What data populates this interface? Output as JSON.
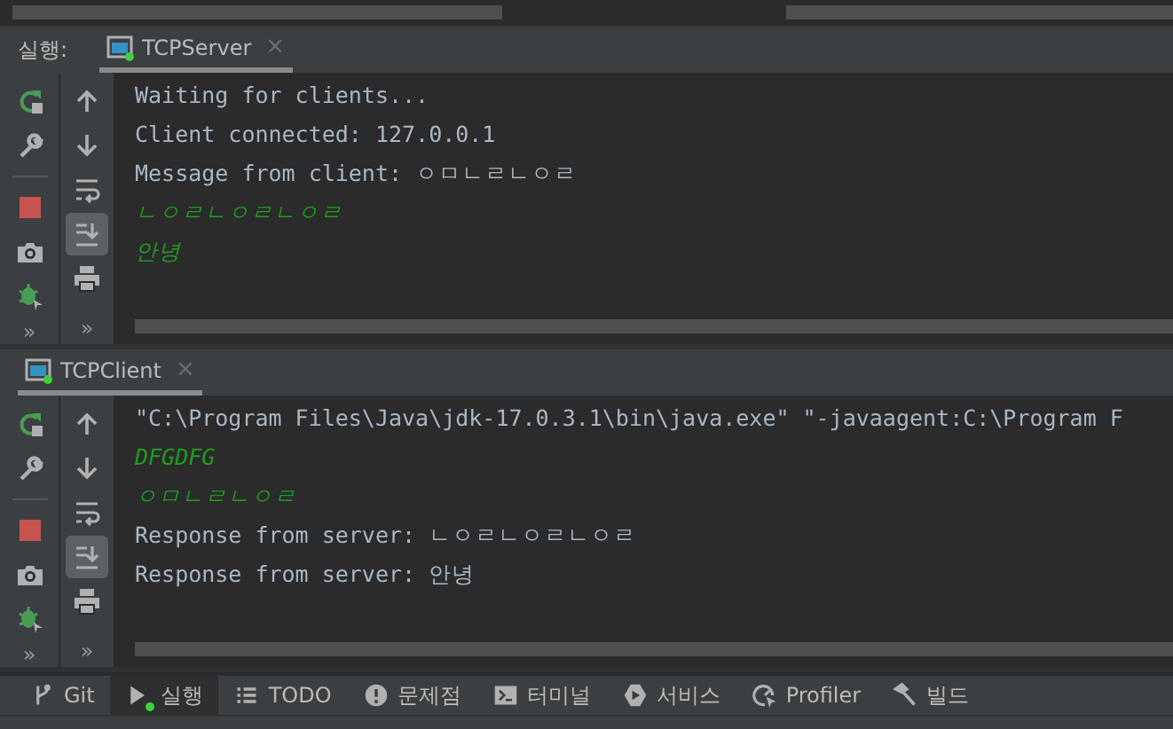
{
  "consoles": [
    {
      "label": "실행:",
      "tab": {
        "title": "TCPServer",
        "close": "×",
        "running": true
      },
      "more_left": "»",
      "more_right": "»",
      "soft_wrap_on": false,
      "scroll_to_end_on": true,
      "lines": [
        {
          "text": "Waiting for clients...",
          "kind": "output"
        },
        {
          "text": "Client connected: 127.0.0.1",
          "kind": "output"
        },
        {
          "text": "Message from client: ㅇㅁㄴㄹㄴㅇㄹ",
          "kind": "output"
        },
        {
          "text": "ㄴㅇㄹㄴㅇㄹㄴㅇㄹ",
          "kind": "input"
        },
        {
          "text": "안녕",
          "kind": "input"
        }
      ]
    },
    {
      "tab": {
        "title": "TCPClient",
        "close": "×",
        "running": true
      },
      "more_left": "»",
      "more_right": "»",
      "soft_wrap_on": false,
      "scroll_to_end_on": true,
      "lines": [
        {
          "text": "\"C:\\Program Files\\Java\\jdk-17.0.3.1\\bin\\java.exe\" \"-javaagent:C:\\Program F",
          "kind": "output"
        },
        {
          "text": "DFGDFG",
          "kind": "input"
        },
        {
          "text": "ㅇㅁㄴㄹㄴㅇㄹ",
          "kind": "input"
        },
        {
          "text": "Response from server: ㄴㅇㄹㄴㅇㄹㄴㅇㄹ",
          "kind": "output"
        },
        {
          "text": "Response from server: 안녕",
          "kind": "output"
        }
      ]
    }
  ],
  "bottom_tabs": [
    {
      "label": "Git",
      "selected": false,
      "running": false
    },
    {
      "label": "실행",
      "selected": true,
      "running": true
    },
    {
      "label": "TODO",
      "selected": false,
      "running": false
    },
    {
      "label": "문제점",
      "selected": false,
      "running": false
    },
    {
      "label": "터미널",
      "selected": false,
      "running": false
    },
    {
      "label": "서비스",
      "selected": false,
      "running": false
    },
    {
      "label": "Profiler",
      "selected": false,
      "running": false
    },
    {
      "label": "빌드",
      "selected": false,
      "running": false
    }
  ]
}
